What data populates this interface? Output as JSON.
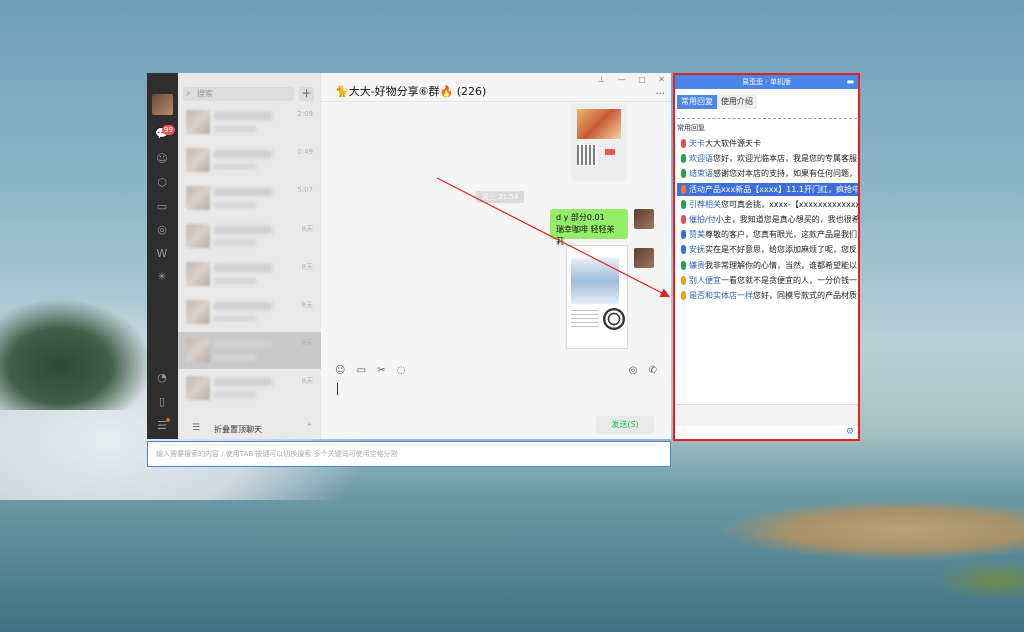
{
  "wechat": {
    "badge_count": "99",
    "search_placeholder": "搜索",
    "plus": "+",
    "fold_label": "折叠置顶聊天",
    "chat_times": [
      "2:09",
      "0:49",
      "5:07",
      "8天",
      "8天",
      "8天",
      "8天",
      "8天"
    ],
    "chat_title": "🐈大大-好物分享⑥群🔥 (226)",
    "time_tag": "周三 21:54",
    "bubble_line1": "d y 部分0.01",
    "bubble_line2": "瑞幸咖啡 轻轻茉莉",
    "send_label": "发送(S)",
    "win_pin": "⊥",
    "win_min": "—",
    "win_max": "□",
    "win_close": "✕",
    "more": "···"
  },
  "bottom_search": {
    "placeholder": "输入需要搜索的内容 / 使用TAB 按键可以切换搜索 多个关键词可使用空格分割"
  },
  "panel": {
    "title": "易歪歪 · 单机版",
    "tabs": [
      "常用回复",
      "使用介绍"
    ],
    "section_label": "常用回复",
    "replies": [
      {
        "key": "天卡",
        "text": "大大软件源天卡",
        "color": "#e05050"
      },
      {
        "key": "欢迎语",
        "text": "您好，欢迎光临本店，我是您的专属客服",
        "color": "#2e9e4f"
      },
      {
        "key": "结束语",
        "text": "感谢您对本店的支持，如果有任何问题，",
        "color": "#2e9e4f"
      },
      {
        "key": "活动产品xxx新品【xxxx】",
        "text": "11.1开门红，疯抢中",
        "color": "#e87b2c",
        "selected": true
      },
      {
        "key": "引荐相关",
        "text": "您可真会挑，xxxx-【xxxxxxxxxxxxxxx",
        "color": "#2e9e4f"
      },
      {
        "key": "催拍/付",
        "text": "小主，我知道您是真心想买的，我也很希",
        "color": "#e05050"
      },
      {
        "key": "赞美",
        "text": "尊敬的客户，您真有眼光，这款产品是我们",
        "color": "#3a6ee0"
      },
      {
        "key": "安抚",
        "text": "实在是不好意思，给您添加麻烦了呢，您反",
        "color": "#3a6ee0"
      },
      {
        "key": "嫌贵",
        "text": "我非常理解你的心情，当然，谁都希望能以",
        "color": "#2e9e4f"
      },
      {
        "key": "别人便宜",
        "text": "一看您就不是贪便宜的人，一分价钱一",
        "color": "#e8a22c"
      },
      {
        "key": "是否和实体店一样",
        "text": "您好，同模号款式的产品材质",
        "color": "#e8a22c"
      }
    ]
  }
}
